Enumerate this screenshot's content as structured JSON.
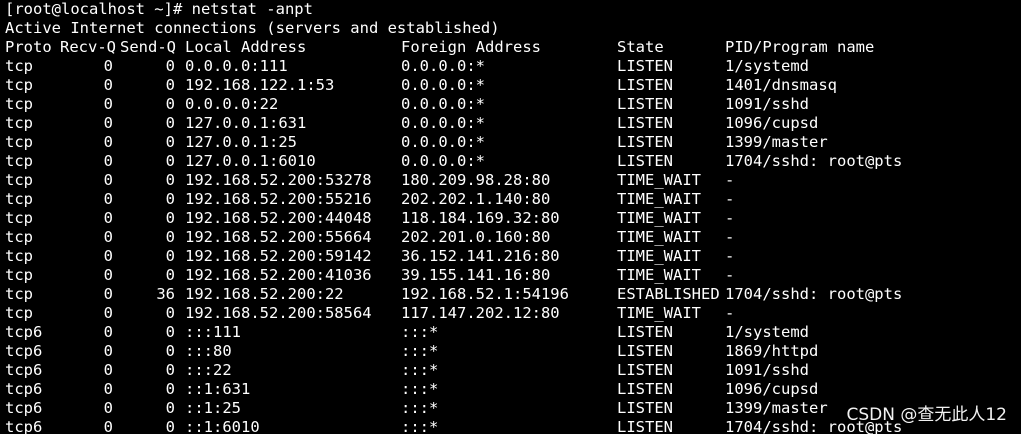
{
  "terminal": {
    "prompt_line": "[root@localhost ~]# netstat -anpt",
    "info_line": "Active Internet connections (servers and established)",
    "headers": {
      "proto": "Proto",
      "recv_q": "Recv-Q",
      "send_q": "Send-Q",
      "local": "Local Address",
      "foreign": "Foreign Address",
      "state": "State",
      "pid": "PID/Program name"
    },
    "rows": [
      {
        "proto": "tcp",
        "recv_q": "0",
        "send_q": "0",
        "local": "0.0.0.0:111",
        "foreign": "0.0.0.0:*",
        "state": "LISTEN",
        "pid": "1/systemd"
      },
      {
        "proto": "tcp",
        "recv_q": "0",
        "send_q": "0",
        "local": "192.168.122.1:53",
        "foreign": "0.0.0.0:*",
        "state": "LISTEN",
        "pid": "1401/dnsmasq"
      },
      {
        "proto": "tcp",
        "recv_q": "0",
        "send_q": "0",
        "local": "0.0.0.0:22",
        "foreign": "0.0.0.0:*",
        "state": "LISTEN",
        "pid": "1091/sshd"
      },
      {
        "proto": "tcp",
        "recv_q": "0",
        "send_q": "0",
        "local": "127.0.0.1:631",
        "foreign": "0.0.0.0:*",
        "state": "LISTEN",
        "pid": "1096/cupsd"
      },
      {
        "proto": "tcp",
        "recv_q": "0",
        "send_q": "0",
        "local": "127.0.0.1:25",
        "foreign": "0.0.0.0:*",
        "state": "LISTEN",
        "pid": "1399/master"
      },
      {
        "proto": "tcp",
        "recv_q": "0",
        "send_q": "0",
        "local": "127.0.0.1:6010",
        "foreign": "0.0.0.0:*",
        "state": "LISTEN",
        "pid": "1704/sshd: root@pts"
      },
      {
        "proto": "tcp",
        "recv_q": "0",
        "send_q": "0",
        "local": "192.168.52.200:53278",
        "foreign": "180.209.98.28:80",
        "state": "TIME_WAIT",
        "pid": "-"
      },
      {
        "proto": "tcp",
        "recv_q": "0",
        "send_q": "0",
        "local": "192.168.52.200:55216",
        "foreign": "202.202.1.140:80",
        "state": "TIME_WAIT",
        "pid": "-"
      },
      {
        "proto": "tcp",
        "recv_q": "0",
        "send_q": "0",
        "local": "192.168.52.200:44048",
        "foreign": "118.184.169.32:80",
        "state": "TIME_WAIT",
        "pid": "-"
      },
      {
        "proto": "tcp",
        "recv_q": "0",
        "send_q": "0",
        "local": "192.168.52.200:55664",
        "foreign": "202.201.0.160:80",
        "state": "TIME_WAIT",
        "pid": "-"
      },
      {
        "proto": "tcp",
        "recv_q": "0",
        "send_q": "0",
        "local": "192.168.52.200:59142",
        "foreign": "36.152.141.216:80",
        "state": "TIME_WAIT",
        "pid": "-"
      },
      {
        "proto": "tcp",
        "recv_q": "0",
        "send_q": "0",
        "local": "192.168.52.200:41036",
        "foreign": "39.155.141.16:80",
        "state": "TIME_WAIT",
        "pid": "-"
      },
      {
        "proto": "tcp",
        "recv_q": "0",
        "send_q": "36",
        "local": "192.168.52.200:22",
        "foreign": "192.168.52.1:54196",
        "state": "ESTABLISHED",
        "pid": "1704/sshd: root@pts"
      },
      {
        "proto": "tcp",
        "recv_q": "0",
        "send_q": "0",
        "local": "192.168.52.200:58564",
        "foreign": "117.147.202.12:80",
        "state": "TIME_WAIT",
        "pid": "-"
      },
      {
        "proto": "tcp6",
        "recv_q": "0",
        "send_q": "0",
        "local": ":::111",
        "foreign": ":::*",
        "state": "LISTEN",
        "pid": "1/systemd"
      },
      {
        "proto": "tcp6",
        "recv_q": "0",
        "send_q": "0",
        "local": ":::80",
        "foreign": ":::*",
        "state": "LISTEN",
        "pid": "1869/httpd"
      },
      {
        "proto": "tcp6",
        "recv_q": "0",
        "send_q": "0",
        "local": ":::22",
        "foreign": ":::*",
        "state": "LISTEN",
        "pid": "1091/sshd"
      },
      {
        "proto": "tcp6",
        "recv_q": "0",
        "send_q": "0",
        "local": "::1:631",
        "foreign": ":::*",
        "state": "LISTEN",
        "pid": "1096/cupsd"
      },
      {
        "proto": "tcp6",
        "recv_q": "0",
        "send_q": "0",
        "local": "::1:25",
        "foreign": ":::*",
        "state": "LISTEN",
        "pid": "1399/master"
      },
      {
        "proto": "tcp6",
        "recv_q": "0",
        "send_q": "0",
        "local": "::1:6010",
        "foreign": ":::*",
        "state": "LISTEN",
        "pid": "1704/sshd: root@pts"
      }
    ]
  },
  "watermark": {
    "text": "CSDN @查无此人12"
  },
  "colors": {
    "background": "#000000",
    "foreground": "#ffffff"
  }
}
